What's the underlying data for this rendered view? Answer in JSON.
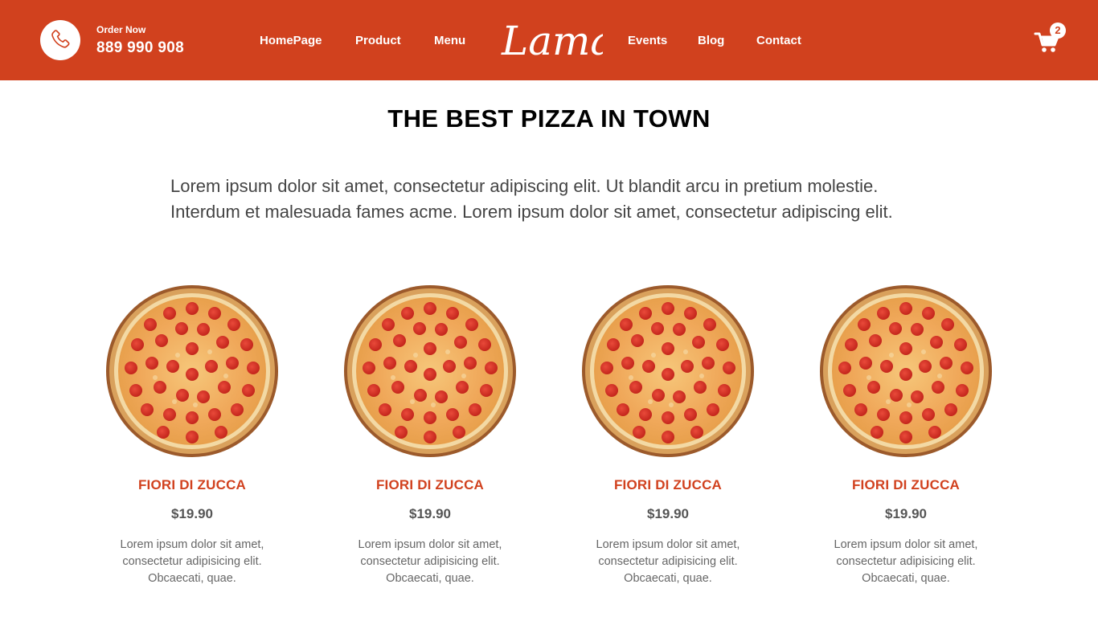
{
  "header": {
    "order_label": "Order Now",
    "phone": "889 990 908",
    "brand": "Lama",
    "nav_left": [
      "HomePage",
      "Product",
      "Menu"
    ],
    "nav_right": [
      "Events",
      "Blog",
      "Contact"
    ],
    "cart_count": "2",
    "colors": {
      "brand": "#d1411e",
      "text": "#ffffff"
    }
  },
  "hero": {
    "title": "THE BEST PIZZA IN TOWN",
    "description": "Lorem ipsum dolor sit amet, consectetur adipiscing elit. Ut blandit arcu in pretium molestie. Interdum et malesuada fames acme. Lorem ipsum dolor sit amet, consectetur adipiscing elit."
  },
  "products": [
    {
      "name": "FIORI DI ZUCCA",
      "price": "$19.90",
      "description": "Lorem ipsum dolor sit amet, consectetur adipisicing elit. Obcaecati, quae."
    },
    {
      "name": "FIORI DI ZUCCA",
      "price": "$19.90",
      "description": "Lorem ipsum dolor sit amet, consectetur adipisicing elit. Obcaecati, quae."
    },
    {
      "name": "FIORI DI ZUCCA",
      "price": "$19.90",
      "description": "Lorem ipsum dolor sit amet, consectetur adipisicing elit. Obcaecati, quae."
    },
    {
      "name": "FIORI DI ZUCCA",
      "price": "$19.90",
      "description": "Lorem ipsum dolor sit amet, consectetur adipisicing elit. Obcaecati, quae."
    }
  ],
  "icons": {
    "phone": "phone-icon",
    "cart": "shopping-cart-icon",
    "product_image": "pepperoni-pizza-image"
  }
}
